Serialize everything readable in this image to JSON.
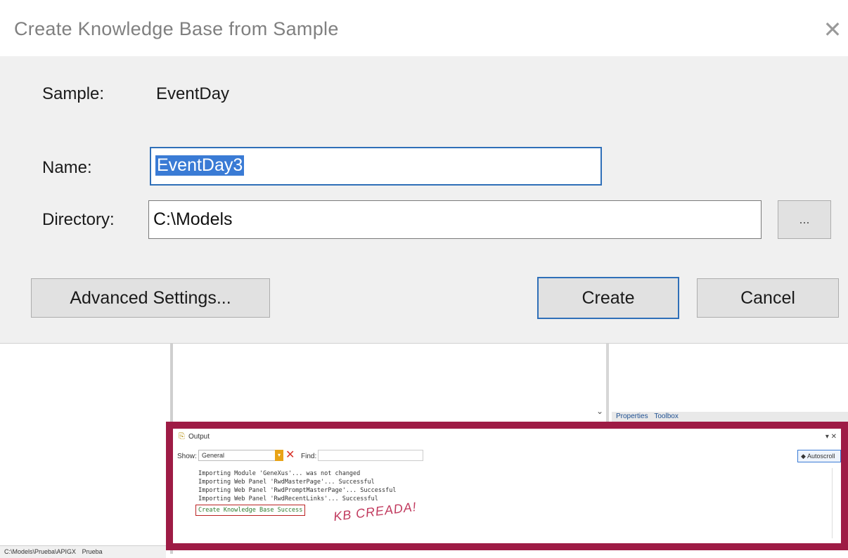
{
  "dialog": {
    "title": "Create Knowledge Base from Sample",
    "sample_label": "Sample:",
    "sample_value": "EventDay",
    "name_label": "Name:",
    "name_value": "EventDay3",
    "directory_label": "Directory:",
    "directory_value": "C:\\Models",
    "browse_label": "...",
    "advanced_label": "Advanced Settings...",
    "create_label": "Create",
    "cancel_label": "Cancel"
  },
  "ide": {
    "right_tabs": [
      "Properties",
      "Toolbox"
    ],
    "status_path": "C:\\Models\\Prueba\\APIGX",
    "status_extra": "Prueba"
  },
  "output": {
    "title": "Output",
    "show_label": "Show:",
    "show_value": "General",
    "find_label": "Find:",
    "autoscroll_label": "Autoscroll",
    "lines": [
      "Importing Module 'GeneXus'... was not changed",
      "Importing Web Panel 'RwdMasterPage'... Successful",
      "Importing Web Panel 'RwdPromptMasterPage'... Successful",
      "Importing Web Panel 'RwdRecentLinks'... Successful"
    ],
    "success_line": "Create Knowledge Base Success",
    "annotation": "KB CREADA!"
  },
  "colors": {
    "accent_blue": "#2f6fb8",
    "highlight_frame": "#9e1b45",
    "success_green": "#2d7a2d"
  }
}
